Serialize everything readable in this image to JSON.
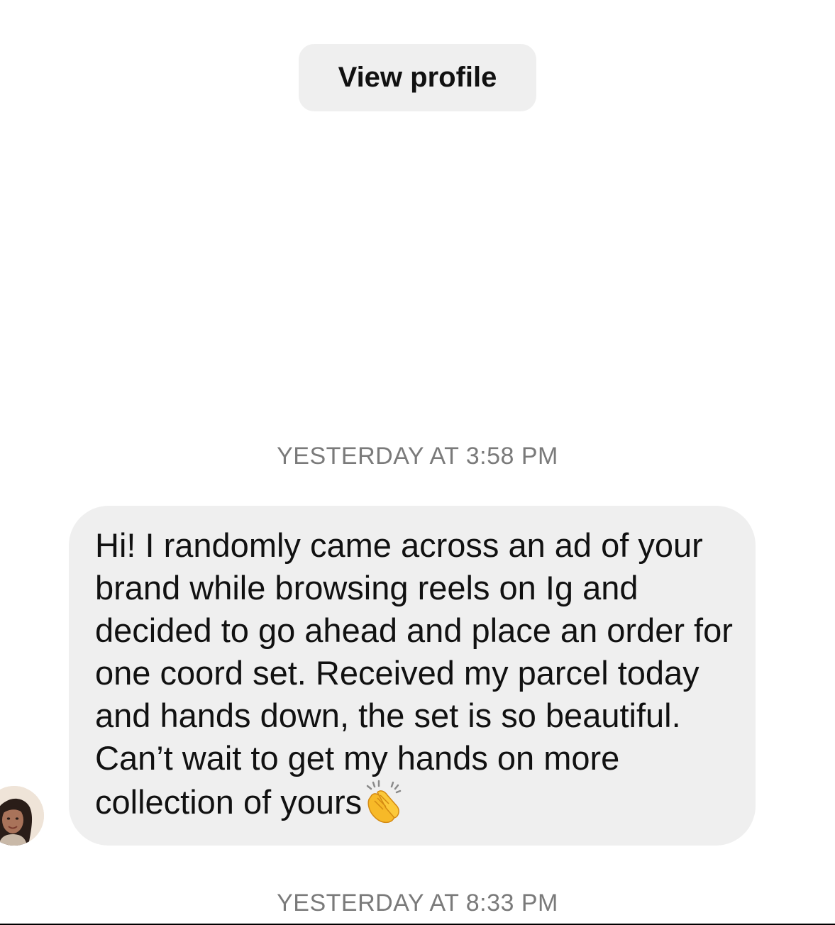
{
  "header": {
    "view_profile_label": "View profile"
  },
  "thread": {
    "timestamp_1": "YESTERDAY AT 3:58 PM",
    "message": {
      "text": "Hi! I randomly came across an ad of your brand while browsing reels on Ig and decided to go ahead and place an order for one coord set. Received my parcel today and hands down, the set is so beautiful. Can’t wait to get my hands on more collection of yours",
      "emoji": "clapping-hands-icon"
    },
    "timestamp_2": "YESTERDAY AT 8:33 PM"
  },
  "colors": {
    "bubble_bg": "#efefef",
    "timestamp_text": "#7a7a7a",
    "clap_yellow": "#f7b928"
  }
}
